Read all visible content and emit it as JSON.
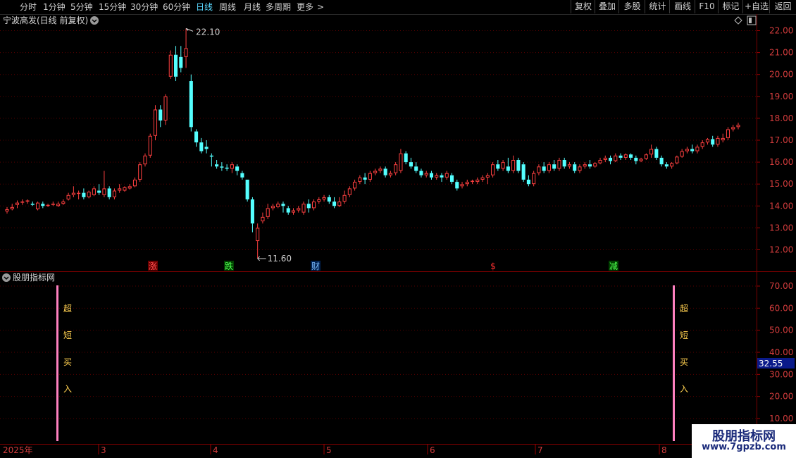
{
  "toolbar": {
    "periods": [
      "分时",
      "1分钟",
      "5分钟",
      "15分钟",
      "30分钟",
      "60分钟",
      "日线",
      "周线",
      "月线",
      "多周期",
      "更多"
    ],
    "active_period": "日线",
    "more_arrow": ">",
    "right_buttons": [
      "复权",
      "叠加",
      "多股",
      "统计",
      "画线",
      "F10",
      "标记",
      "+自选",
      "返回"
    ]
  },
  "main_panel": {
    "title": "宁波高发(日线 前复权)",
    "dropdown_icon": "chevron-down-icon",
    "diamond_icon": "diamond-icon",
    "panel_icon": "panel-toggle-icon",
    "high_label": "22.10",
    "low_label": "11.60",
    "event_markers": [
      {
        "text": "涨",
        "color": "#ff5050",
        "bg": "#6a0000"
      },
      {
        "text": "跌",
        "color": "#50ff50",
        "bg": "#004000"
      },
      {
        "text": "财",
        "color": "#7fbfff",
        "bg": "#002050"
      },
      {
        "text": "$",
        "color": "#ff3030",
        "bg": "#000000"
      },
      {
        "text": "减",
        "color": "#50ff50",
        "bg": "#004000"
      }
    ]
  },
  "indicator_panel": {
    "title": "股朋指标网",
    "dropdown_icon": "chevron-down-icon",
    "signal_chars": [
      "超",
      "短",
      "买",
      "入"
    ],
    "current_value": "32.55"
  },
  "date_axis": {
    "labels": [
      "2025年",
      "3",
      "4",
      "5",
      "6",
      "7",
      "8"
    ]
  },
  "watermark": {
    "title": "股朋指标网",
    "url": "www.7gpzb.com"
  },
  "colors": {
    "up": "#ff4040",
    "down": "#54ffff",
    "grid": "#5a0000",
    "axis_text": "#d23c3c",
    "active": "#5ad8ff",
    "signal_line": "#ff80c0",
    "signal_text": "#ffd050",
    "value_box": "#0a1a8a"
  },
  "chart_data": [
    {
      "type": "candlestick",
      "title": "宁波高发(日线 前复权)",
      "y_ticks": [
        12.0,
        13.0,
        14.0,
        15.0,
        16.0,
        17.0,
        18.0,
        19.0,
        20.0,
        21.0,
        22.0
      ],
      "ylim": [
        11.3,
        22.4
      ],
      "max_price": 22.1,
      "min_price": 11.6,
      "candles": [
        [
          13.75,
          13.95,
          13.85,
          13.65
        ],
        [
          13.85,
          14.1,
          13.95,
          13.8
        ],
        [
          14.05,
          14.25,
          14.15,
          13.9
        ],
        [
          14.15,
          14.3,
          14.2,
          14.05
        ],
        [
          14.2,
          14.3,
          14.25,
          14.1
        ],
        [
          14.1,
          14.2,
          14.05,
          14.0
        ],
        [
          13.85,
          14.2,
          14.15,
          13.8
        ],
        [
          14.1,
          14.2,
          14.0,
          13.9
        ],
        [
          14.0,
          14.1,
          14.05,
          13.95
        ],
        [
          14.05,
          14.2,
          14.1,
          14.0
        ],
        [
          14.0,
          14.2,
          14.1,
          13.95
        ],
        [
          14.1,
          14.3,
          14.2,
          14.05
        ],
        [
          14.3,
          14.6,
          14.5,
          14.25
        ],
        [
          14.5,
          14.9,
          14.6,
          14.4
        ],
        [
          14.55,
          14.7,
          14.6,
          14.3
        ],
        [
          14.6,
          14.8,
          14.4,
          14.3
        ],
        [
          14.4,
          14.7,
          14.65,
          14.35
        ],
        [
          14.5,
          14.9,
          14.8,
          14.45
        ],
        [
          14.7,
          15.0,
          14.6,
          14.5
        ],
        [
          14.5,
          15.6,
          14.8,
          14.4
        ],
        [
          14.8,
          14.9,
          14.4,
          14.3
        ],
        [
          14.4,
          14.8,
          14.7,
          14.3
        ],
        [
          14.7,
          15.0,
          14.8,
          14.6
        ],
        [
          14.7,
          14.9,
          14.85,
          14.65
        ],
        [
          14.8,
          15.0,
          14.9,
          14.75
        ],
        [
          14.9,
          15.3,
          15.2,
          14.85
        ],
        [
          15.2,
          16.0,
          15.9,
          15.1
        ],
        [
          15.9,
          16.4,
          16.3,
          15.8
        ],
        [
          16.3,
          17.3,
          17.2,
          16.2
        ],
        [
          17.2,
          18.6,
          18.4,
          17.0
        ],
        [
          18.4,
          18.6,
          17.9,
          17.6
        ],
        [
          17.9,
          19.1,
          19.0,
          17.7
        ],
        [
          19.9,
          21.1,
          20.9,
          19.8
        ],
        [
          20.9,
          21.3,
          19.9,
          19.7
        ],
        [
          20.8,
          21.3,
          20.3,
          20.1
        ],
        [
          20.8,
          22.1,
          21.2,
          20.3
        ],
        [
          19.7,
          20.0,
          17.6,
          17.4
        ],
        [
          17.4,
          17.5,
          16.9,
          16.7
        ],
        [
          16.9,
          17.1,
          16.5,
          16.4
        ],
        [
          16.7,
          17.0,
          16.6,
          16.4
        ],
        [
          16.3,
          16.4,
          16.25,
          15.8
        ],
        [
          15.9,
          16.1,
          15.8,
          15.7
        ],
        [
          15.8,
          16.0,
          15.75,
          15.6
        ],
        [
          15.75,
          15.9,
          15.7,
          15.6
        ],
        [
          15.7,
          16.0,
          15.9,
          15.5
        ],
        [
          15.8,
          15.9,
          15.6,
          15.4
        ],
        [
          15.5,
          15.6,
          15.3,
          15.2
        ],
        [
          15.2,
          15.2,
          14.3,
          14.2
        ],
        [
          14.3,
          14.4,
          13.2,
          12.8
        ],
        [
          12.4,
          13.2,
          13.0,
          11.6
        ],
        [
          13.3,
          13.7,
          13.5,
          13.2
        ],
        [
          13.5,
          14.1,
          13.9,
          13.4
        ],
        [
          13.9,
          14.1,
          14.0,
          13.8
        ],
        [
          13.95,
          14.2,
          14.1,
          13.9
        ],
        [
          14.1,
          14.2,
          14.0,
          13.7
        ],
        [
          13.9,
          14.0,
          13.7,
          13.6
        ],
        [
          13.7,
          13.9,
          13.8,
          13.6
        ],
        [
          13.8,
          14.0,
          13.9,
          13.7
        ],
        [
          13.7,
          14.2,
          14.1,
          13.6
        ],
        [
          14.1,
          14.3,
          13.9,
          13.7
        ],
        [
          13.9,
          14.3,
          14.2,
          13.8
        ],
        [
          14.2,
          14.4,
          14.3,
          14.1
        ],
        [
          14.3,
          14.5,
          14.4,
          14.2
        ],
        [
          14.4,
          14.5,
          14.2,
          14.1
        ],
        [
          14.2,
          14.4,
          14.0,
          13.9
        ],
        [
          14.0,
          14.4,
          14.2,
          13.95
        ],
        [
          14.2,
          14.7,
          14.5,
          14.1
        ],
        [
          14.5,
          14.9,
          14.8,
          14.4
        ],
        [
          14.8,
          15.2,
          15.1,
          14.7
        ],
        [
          15.1,
          15.4,
          15.3,
          15.0
        ],
        [
          15.3,
          15.5,
          15.2,
          15.0
        ],
        [
          15.2,
          15.6,
          15.5,
          15.1
        ],
        [
          15.5,
          15.7,
          15.6,
          15.4
        ],
        [
          15.6,
          15.8,
          15.7,
          15.5
        ],
        [
          15.7,
          15.8,
          15.4,
          15.3
        ],
        [
          15.4,
          15.6,
          15.5,
          15.3
        ],
        [
          15.5,
          16.0,
          15.9,
          15.4
        ],
        [
          15.6,
          16.6,
          16.4,
          15.5
        ],
        [
          16.4,
          16.5,
          16.0,
          15.9
        ],
        [
          16.0,
          16.2,
          15.8,
          15.7
        ],
        [
          15.8,
          16.0,
          15.6,
          15.5
        ],
        [
          15.6,
          15.7,
          15.4,
          15.3
        ],
        [
          15.4,
          15.6,
          15.5,
          15.3
        ],
        [
          15.5,
          15.6,
          15.3,
          15.2
        ],
        [
          15.3,
          15.5,
          15.4,
          15.2
        ],
        [
          15.4,
          15.5,
          15.3,
          15.1
        ],
        [
          15.3,
          15.6,
          15.5,
          15.2
        ],
        [
          15.4,
          15.5,
          15.1,
          15.0
        ],
        [
          15.1,
          15.2,
          14.8,
          14.7
        ],
        [
          14.9,
          15.1,
          15.0,
          14.8
        ],
        [
          15.0,
          15.2,
          15.1,
          14.9
        ],
        [
          15.1,
          15.2,
          15.15,
          15.0
        ],
        [
          15.1,
          15.3,
          15.2,
          15.0
        ],
        [
          15.2,
          15.4,
          15.3,
          15.1
        ],
        [
          15.3,
          15.5,
          15.4,
          15.0
        ],
        [
          15.4,
          16.0,
          15.9,
          15.3
        ],
        [
          15.9,
          16.1,
          15.7,
          15.6
        ],
        [
          15.7,
          16.1,
          16.0,
          15.6
        ],
        [
          15.8,
          16.2,
          15.6,
          15.5
        ],
        [
          15.6,
          16.3,
          16.1,
          15.5
        ],
        [
          16.1,
          16.2,
          15.6,
          15.5
        ],
        [
          15.9,
          16.0,
          15.2,
          15.1
        ],
        [
          15.2,
          15.4,
          15.0,
          14.9
        ],
        [
          15.0,
          15.6,
          15.5,
          14.9
        ],
        [
          15.5,
          15.9,
          15.8,
          15.4
        ],
        [
          15.8,
          16.0,
          15.6,
          15.5
        ],
        [
          15.6,
          16.0,
          15.9,
          15.5
        ],
        [
          15.9,
          16.1,
          15.7,
          15.6
        ],
        [
          15.7,
          16.2,
          16.1,
          15.6
        ],
        [
          16.1,
          16.2,
          15.8,
          15.7
        ],
        [
          15.8,
          16.0,
          15.9,
          15.7
        ],
        [
          15.9,
          16.0,
          15.6,
          15.5
        ],
        [
          15.6,
          15.9,
          15.8,
          15.5
        ],
        [
          15.8,
          16.0,
          15.9,
          15.7
        ],
        [
          15.9,
          16.1,
          15.8,
          15.7
        ],
        [
          15.8,
          16.0,
          15.95,
          15.75
        ],
        [
          15.95,
          16.2,
          16.1,
          15.9
        ],
        [
          16.1,
          16.3,
          16.2,
          16.0
        ],
        [
          16.2,
          16.3,
          16.05,
          15.9
        ],
        [
          16.05,
          16.4,
          16.3,
          16.0
        ],
        [
          16.3,
          16.4,
          16.2,
          16.1
        ],
        [
          16.2,
          16.4,
          16.35,
          16.1
        ],
        [
          16.35,
          16.4,
          16.2,
          16.1
        ],
        [
          16.2,
          16.3,
          16.05,
          15.9
        ],
        [
          16.05,
          16.2,
          16.15,
          16.0
        ],
        [
          16.15,
          16.4,
          16.35,
          16.1
        ],
        [
          16.35,
          16.8,
          16.6,
          16.2
        ],
        [
          16.6,
          16.7,
          16.2,
          16.1
        ],
        [
          16.2,
          16.3,
          15.9,
          15.8
        ],
        [
          15.9,
          16.0,
          15.8,
          15.7
        ],
        [
          15.8,
          16.0,
          15.95,
          15.7
        ],
        [
          15.95,
          16.3,
          16.25,
          15.9
        ],
        [
          16.25,
          16.6,
          16.5,
          16.2
        ],
        [
          16.5,
          16.7,
          16.6,
          16.4
        ],
        [
          16.6,
          16.8,
          16.5,
          16.4
        ],
        [
          16.5,
          16.8,
          16.7,
          16.4
        ],
        [
          16.7,
          17.0,
          16.9,
          16.6
        ],
        [
          16.9,
          17.1,
          17.05,
          16.8
        ],
        [
          17.05,
          17.2,
          16.8,
          16.7
        ],
        [
          16.8,
          17.2,
          17.1,
          16.7
        ],
        [
          17.0,
          17.3,
          17.1,
          16.9
        ],
        [
          17.1,
          17.6,
          17.5,
          17.0
        ],
        [
          17.5,
          17.7,
          17.6,
          17.4
        ],
        [
          17.6,
          17.8,
          17.7,
          17.5
        ]
      ]
    },
    {
      "type": "indicator",
      "title": "股朋指标网",
      "y_ticks": [
        10.0,
        20.0,
        30.0,
        40.0,
        50.0,
        60.0,
        70.0
      ],
      "ylim": [
        10,
        72
      ],
      "current_value": 32.55,
      "buy_signals": [
        {
          "x_index": 15,
          "label": "超短买入"
        },
        {
          "x_index": 144,
          "label": "超短买入"
        }
      ]
    }
  ]
}
